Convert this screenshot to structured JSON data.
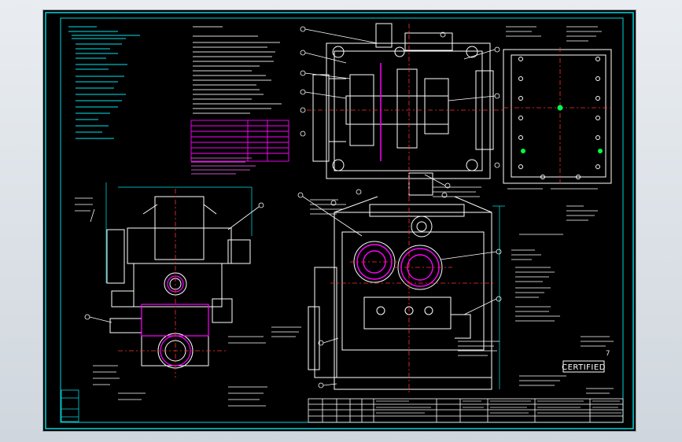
{
  "title_block": {
    "certified_stamp": "CERTIFIED",
    "sheet_mark": "7"
  },
  "colors": {
    "background": "#000000",
    "frame": "#00d7e0",
    "drawing_lines": "#ffffff",
    "annotation_text": "#e6e6e6",
    "center_lines": "#ff3030",
    "highlight": "#ff00ff",
    "marker": "#00ff40",
    "leaders": "#ffff40"
  },
  "views": [
    {
      "name": "gearbox-top-section-view"
    },
    {
      "name": "mounting-plate-plan-view"
    },
    {
      "name": "gearbox-side-elevation"
    },
    {
      "name": "gearbox-front-elevation"
    },
    {
      "name": "notes-table"
    },
    {
      "name": "title-block"
    }
  ]
}
